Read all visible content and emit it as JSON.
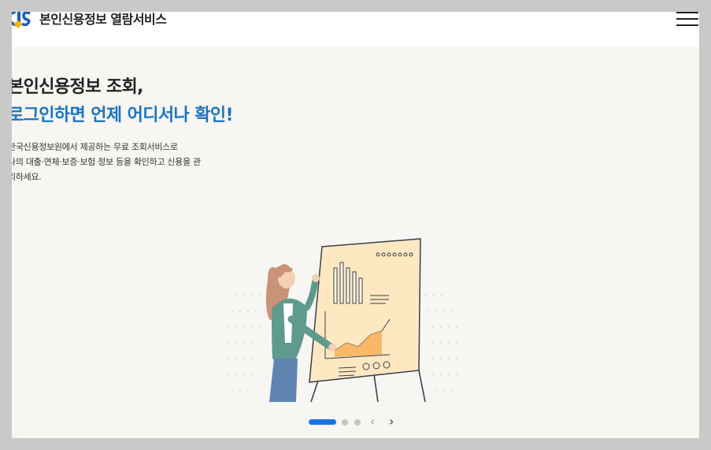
{
  "header": {
    "brand": "본인신용정보 열람서비스",
    "logo_icon": "cis-logo-icon",
    "menu_icon": "hamburger-menu-icon"
  },
  "hero": {
    "headline_line1": "본인신용정보 조회,",
    "headline_line2": "로그인하면 언제 어디서나 확인!",
    "description_line1": "한국신용정보원에서 제공하는 무료 조회서비스로",
    "description_line2": "나의 대출·연체·보증·보험 정보 등을 확인하고 신용을 관",
    "description_line3": "리하세요.",
    "illustration": "presenter-with-chart-board-illustration"
  },
  "pager": {
    "slide_count": 3,
    "active_index": 0,
    "prev_icon": "chevron-left-icon",
    "next_icon": "chevron-right-icon",
    "prev_glyph": "‹",
    "next_glyph": "›"
  },
  "colors": {
    "accent": "#1a73c2",
    "pager_active": "#1a73e8",
    "background": "#f7f6f3"
  }
}
